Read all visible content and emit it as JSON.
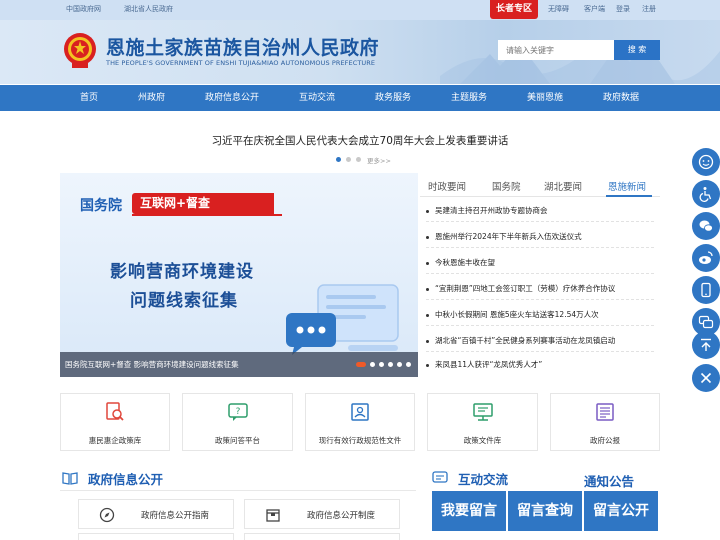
{
  "topbar": {
    "links_left": [
      "中国政府网",
      "湖北省人民政府"
    ],
    "elder_mode": "长者专区",
    "links_right": [
      "无障碍",
      "客户端",
      "登录",
      "注册"
    ]
  },
  "header": {
    "title": "恩施土家族苗族自治州人民政府",
    "subtitle": "THE PEOPLE'S GOVERNMENT OF ENSHI TUJIA&MIAO AUTONOMOUS PREFECTURE",
    "search_placeholder": "请输入关键字",
    "search_button": "搜 索"
  },
  "nav": {
    "items": [
      "首页",
      "州政府",
      "政府信息公开",
      "互动交流",
      "政务服务",
      "主题服务",
      "美丽恩施",
      "政府数据"
    ]
  },
  "headline": {
    "text": "习近平在庆祝全国人民代表大会成立70周年大会上发表重要讲话",
    "more": "更多>>"
  },
  "slider": {
    "brand": "国务院",
    "tag": "互联网+督查",
    "line1": "影响营商环境建设",
    "line2": "问题线索征集",
    "caption": "国务院互联网+督查 影响营商环境建设问题线索征集"
  },
  "news": {
    "tabs": [
      "时政要闻",
      "国务院",
      "湖北要闻",
      "恩施新闻"
    ],
    "active_tab": "恩施新闻",
    "items": [
      "吴建清主持召开州政协专题协商会",
      "恩施州举行2024年下半年新兵入伍欢送仪式",
      "今秋恩施丰收在望",
      "“宜荆荆恩”四地工会签订职工（劳模）疗休养合作协议",
      "中秋小长假期间 恩施5座火车站送客12.54万人次",
      "湖北省“百镇千村”全民健身系列赛事活动在龙凤镇启动",
      "来凤县11人获评“龙凤优秀人才”"
    ]
  },
  "services": [
    {
      "label": "惠民惠企政策库",
      "icon": "policy-search-icon"
    },
    {
      "label": "政策问答平台",
      "icon": "qa-chat-icon"
    },
    {
      "label": "现行有效行政规范性文件",
      "icon": "document-people-icon"
    },
    {
      "label": "政策文件库",
      "icon": "monitor-doc-icon"
    },
    {
      "label": "政府公报",
      "icon": "gazette-icon"
    }
  ],
  "gov_info": {
    "title": "政府信息公开",
    "buttons": [
      "政府信息公开指南",
      "政府信息公开制度"
    ]
  },
  "interaction": {
    "title": "互动交流",
    "tiles": [
      "我要留言",
      "留言查询",
      "留言公开"
    ]
  },
  "notice": {
    "title": "通知公告"
  },
  "colors": {
    "primary": "#2f76c4",
    "title_blue": "#1b56a0",
    "accent_red": "#d92020"
  }
}
